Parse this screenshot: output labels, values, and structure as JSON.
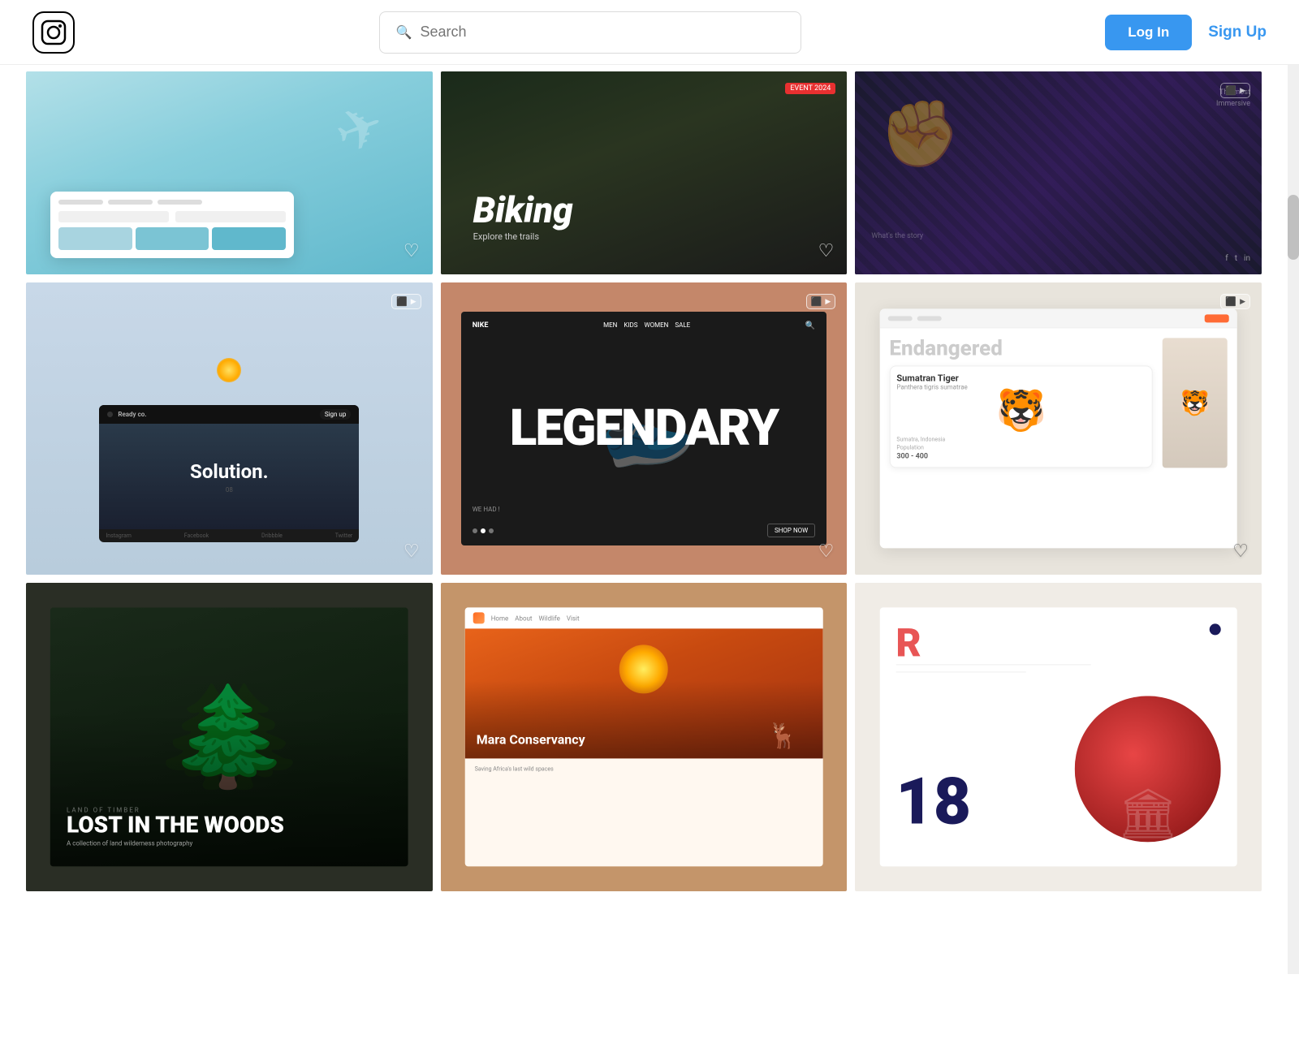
{
  "header": {
    "logo_label": "Instagram logo",
    "search_placeholder": "Search",
    "search_label": "Search",
    "login_label": "Log In",
    "signup_label": "Sign Up"
  },
  "grid": {
    "rows": [
      {
        "cards": [
          {
            "id": "card-1",
            "type": "travel-ui",
            "bg_description": "Travel booking UI with aerial ocean view",
            "heart": true,
            "video_badge": false
          },
          {
            "id": "card-2",
            "type": "biking",
            "bg_description": "Dark biking website design",
            "title": "Biking",
            "heart": true,
            "video_badge": false
          },
          {
            "id": "card-3",
            "type": "dark-hero",
            "bg_description": "Dark superhero/movie website",
            "tagline_top": "The most",
            "tagline_bottom": "Immersive",
            "heart": false,
            "video_badge_count": "1+"
          }
        ]
      },
      {
        "cards": [
          {
            "id": "card-4",
            "type": "solution",
            "bg_description": "Ready co website with mountain background",
            "brand": "Ready co.",
            "cta": "Sign up",
            "main_text": "Solution.",
            "num": "08",
            "socials": [
              "Instagram",
              "Facebook",
              "Dribbble",
              "Twitter"
            ],
            "heart": true,
            "video_badge": true
          },
          {
            "id": "card-5",
            "type": "nike-legendary",
            "bg_description": "Nike Legendary shoe product page",
            "title": "LEGENDARY",
            "sub": "WE HAD !",
            "shop_now": "SHOP NOW",
            "heart": true,
            "video_badge": true
          },
          {
            "id": "card-6",
            "type": "endangered",
            "bg_description": "Endangered species UI with tiger",
            "main_title": "Endangered",
            "animal_name": "Sumatran Tiger",
            "scientific": "Panthera tigris sumatrae",
            "location": "Sumatra, Indonesia",
            "population_label": "Population",
            "population": "300 - 400",
            "heart": true,
            "video_badge": true
          }
        ]
      },
      {
        "cards": [
          {
            "id": "card-7",
            "type": "lost-in-woods",
            "bg_description": "Dark forest photography",
            "series": "Land of Timber",
            "title": "LOST IN THE WOODS",
            "subtitle": "A collection of land wilderness photography",
            "heart": false,
            "video_badge": false
          },
          {
            "id": "card-8",
            "type": "mara",
            "bg_description": "Mara Conservancy wildlife page",
            "title": "Mara Conservancy",
            "sub_text": "Saving Africa's last wild spaces",
            "heart": false,
            "video_badge": false
          },
          {
            "id": "card-9",
            "type": "r-magazine",
            "bg_description": "R magazine design with red circle",
            "letter": "R",
            "number": "18",
            "heart": false,
            "video_badge": false
          }
        ]
      }
    ]
  }
}
